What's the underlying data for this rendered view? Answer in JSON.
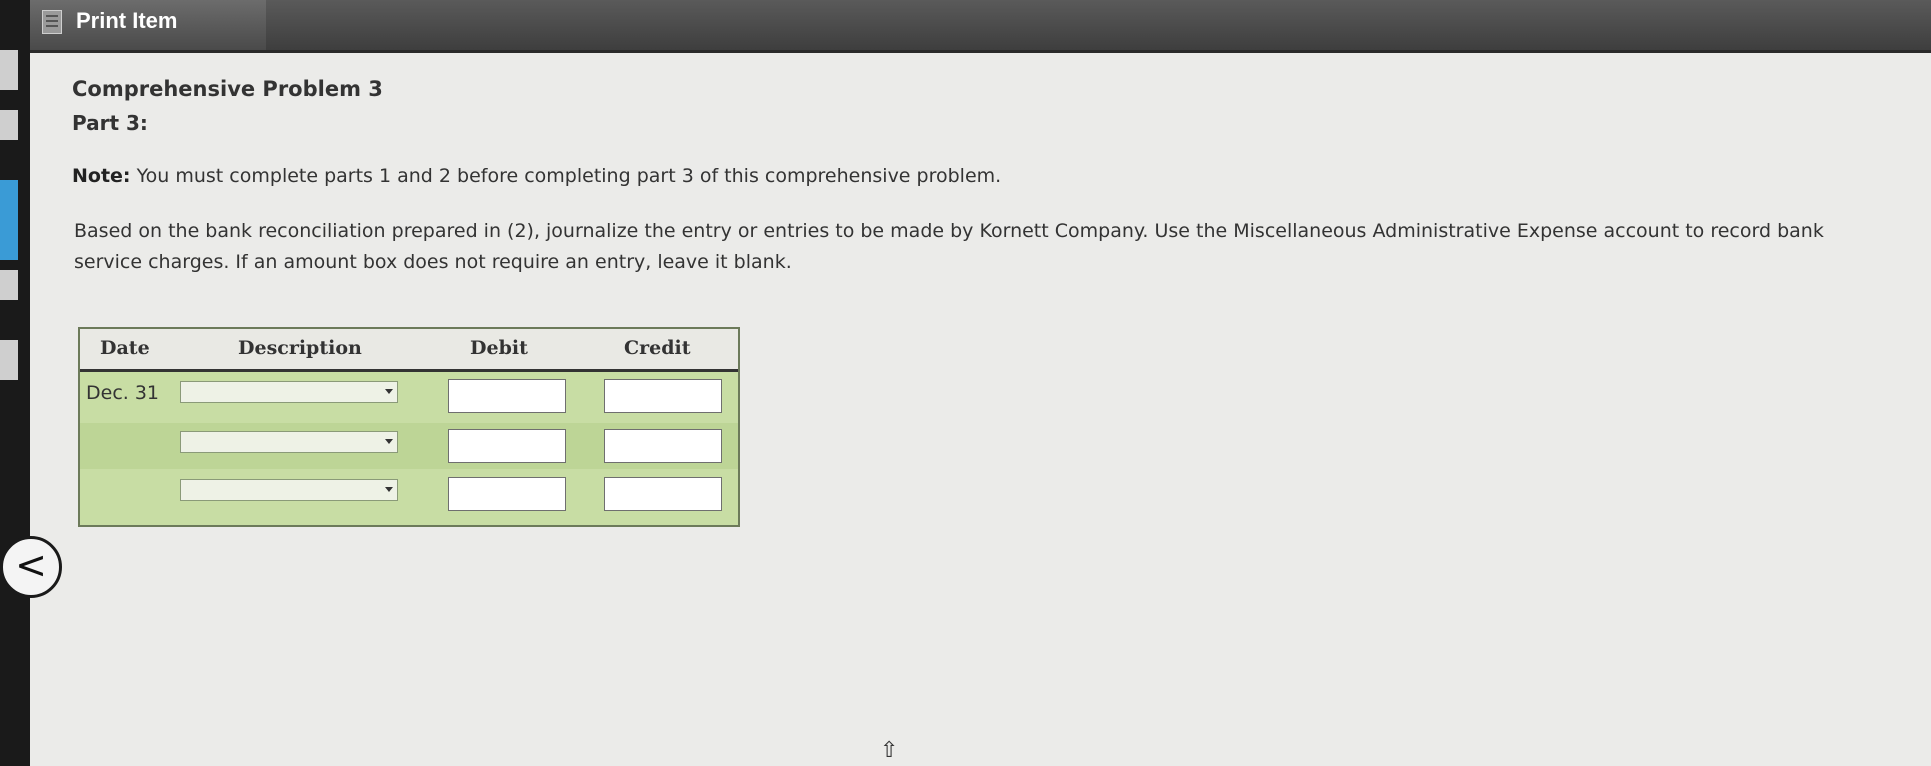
{
  "window": {
    "title": "Print Item"
  },
  "problem": {
    "title": "Comprehensive Problem 3",
    "part": "Part 3:",
    "note_label": "Note:",
    "note_text": " You must complete parts 1 and 2 before completing part 3 of this comprehensive problem.",
    "instructions_line1": "Based on the bank reconciliation prepared in (2), journalize the entry or entries to be made by Kornett Company. Use the Miscellaneous Administrative Expense account to record bank",
    "instructions_line2": "service charges. If an amount box does not require an entry, leave it blank."
  },
  "journal": {
    "headers": {
      "date": "Date",
      "description": "Description",
      "debit": "Debit",
      "credit": "Credit"
    },
    "rows": [
      {
        "date": "Dec. 31",
        "description": "",
        "debit": "",
        "credit": ""
      },
      {
        "date": "",
        "description": "",
        "debit": "",
        "credit": ""
      },
      {
        "date": "",
        "description": "",
        "debit": "",
        "credit": ""
      }
    ]
  },
  "nav": {
    "back_glyph": "<"
  },
  "colors": {
    "title_bar": "#4a4a4a",
    "table_bg": "#c8dda4",
    "content_bg": "#ebebe9"
  }
}
